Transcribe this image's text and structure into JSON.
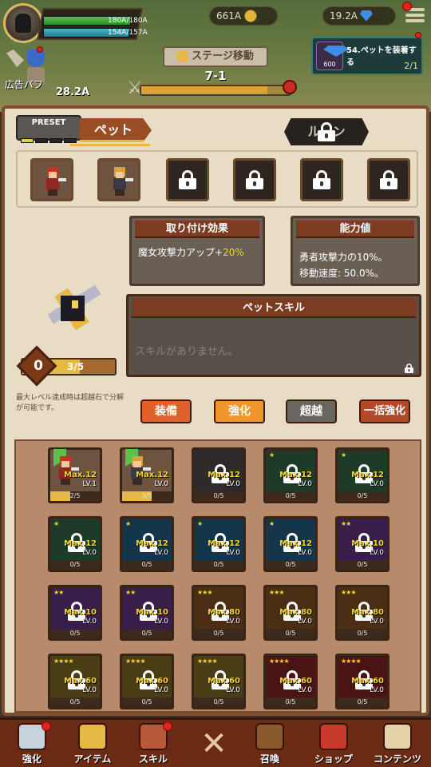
{
  "top": {
    "hp_text": "180A/180A",
    "mp_text": "154A/157A",
    "mp_fraction": 0.98,
    "gold": "661A",
    "gems": "19.2A",
    "stage_button": "ステージ移動",
    "stage": "7-1",
    "stage_progress": 0.85,
    "buff_label": "広告バフ",
    "buff_value": "28.2A",
    "quest": {
      "reward": "600",
      "title": "54.ペットを装着する",
      "count": "2/1"
    }
  },
  "panel": {
    "preset_label": "PRESET",
    "tab_pet": "ペット",
    "tab_rune": "ルーン",
    "slots": [
      {
        "state": "filled",
        "sprite": "red"
      },
      {
        "state": "filled",
        "sprite": "blonde"
      },
      {
        "state": "locked"
      },
      {
        "state": "locked"
      },
      {
        "state": "locked"
      },
      {
        "state": "locked"
      }
    ],
    "attach": {
      "title": "取り付け効果",
      "text": "魔女攻撃力アップ+",
      "percent": "20%"
    },
    "stats": {
      "title": "能力値",
      "line1": "勇者攻撃力の10%。",
      "line2": "移動速度: 50.0%。"
    },
    "skill": {
      "title": "ペットスキル",
      "empty": "スキルがありません。"
    },
    "level": "0",
    "level_progress": "3/5",
    "hint": "最大レベル達成時は超越石で分解が可能です。",
    "buttons": {
      "equip": "装備",
      "upgrade": "強化",
      "limit": "超越",
      "bulk": "一括強化"
    }
  },
  "grid": {
    "cards": [
      {
        "tier": "common",
        "max": "Max.12",
        "lv": "LV.1",
        "progress": "2/5",
        "fill": 0.4,
        "flag": true,
        "locked": false
      },
      {
        "tier": "common",
        "max": "Max.12",
        "lv": "LV.0",
        "progress": "3/5",
        "fill": 0.6,
        "flag": true,
        "locked": false
      },
      {
        "tier": "grey",
        "max": "Max.12",
        "lv": "LV.0",
        "progress": "0/5",
        "fill": 0,
        "locked": true
      },
      {
        "tier": "green",
        "max": "Max.12",
        "lv": "LV.0",
        "progress": "0/5",
        "fill": 0,
        "locked": true,
        "stars": "★"
      },
      {
        "tier": "green",
        "max": "Max.12",
        "lv": "LV.0",
        "progress": "0/5",
        "fill": 0,
        "locked": true,
        "stars": "★"
      },
      {
        "tier": "green",
        "max": "Max.12",
        "lv": "LV.0",
        "progress": "0/5",
        "fill": 0,
        "locked": true,
        "stars": "★"
      },
      {
        "tier": "teal",
        "max": "Max.12",
        "lv": "LV.0",
        "progress": "0/5",
        "fill": 0,
        "locked": true,
        "stars": "★"
      },
      {
        "tier": "teal",
        "max": "Max.12",
        "lv": "LV.0",
        "progress": "0/5",
        "fill": 0,
        "locked": true,
        "stars": "★"
      },
      {
        "tier": "teal",
        "max": "Max.12",
        "lv": "LV.0",
        "progress": "0/5",
        "fill": 0,
        "locked": true,
        "stars": "★"
      },
      {
        "tier": "purple",
        "max": "Max.10",
        "lv": "LV.0",
        "progress": "0/5",
        "fill": 0,
        "locked": true,
        "stars": "★★"
      },
      {
        "tier": "purple",
        "max": "Max.10",
        "lv": "LV.0",
        "progress": "0/5",
        "fill": 0,
        "locked": true,
        "stars": "★★"
      },
      {
        "tier": "purple",
        "max": "Max.10",
        "lv": "LV.0",
        "progress": "0/5",
        "fill": 0,
        "locked": true,
        "stars": "★★"
      },
      {
        "tier": "orange",
        "max": "Max.80",
        "lv": "LV.0",
        "progress": "0/5",
        "fill": 0,
        "locked": true,
        "stars": "★★★"
      },
      {
        "tier": "orange",
        "max": "Max.80",
        "lv": "LV.0",
        "progress": "0/5",
        "fill": 0,
        "locked": true,
        "stars": "★★★"
      },
      {
        "tier": "orange",
        "max": "Max.80",
        "lv": "LV.0",
        "progress": "0/5",
        "fill": 0,
        "locked": true,
        "stars": "★★★"
      },
      {
        "tier": "gold",
        "max": "Max.60",
        "lv": "LV.0",
        "progress": "0/5",
        "fill": 0,
        "locked": true,
        "stars": "★★★★"
      },
      {
        "tier": "gold",
        "max": "Max.60",
        "lv": "LV.0",
        "progress": "0/5",
        "fill": 0,
        "locked": true,
        "stars": "★★★★"
      },
      {
        "tier": "gold",
        "max": "Max.60",
        "lv": "LV.0",
        "progress": "0/5",
        "fill": 0,
        "locked": true,
        "stars": "★★★★"
      },
      {
        "tier": "red",
        "max": "Max.60",
        "lv": "LV.0",
        "progress": "0/5",
        "fill": 0,
        "locked": true,
        "stars": "★★★★"
      },
      {
        "tier": "red",
        "max": "Max.60",
        "lv": "LV.0",
        "progress": "0/5",
        "fill": 0,
        "locked": true,
        "stars": "★★★★"
      }
    ]
  },
  "nav": [
    {
      "label": "強化",
      "icon": "sword-icon",
      "badge": true
    },
    {
      "label": "アイテム",
      "icon": "armor-icon",
      "badge": false
    },
    {
      "label": "スキル",
      "icon": "book-icon",
      "badge": true
    },
    {
      "label": "召喚",
      "icon": "chest-icon",
      "badge": false
    },
    {
      "label": "ショップ",
      "icon": "shop-icon",
      "badge": false
    },
    {
      "label": "コンテンツ",
      "icon": "map-icon",
      "badge": false
    }
  ],
  "colors": {
    "accent": "#e6b846",
    "panel": "#e8dcc4",
    "nav": "#6b2a14"
  }
}
